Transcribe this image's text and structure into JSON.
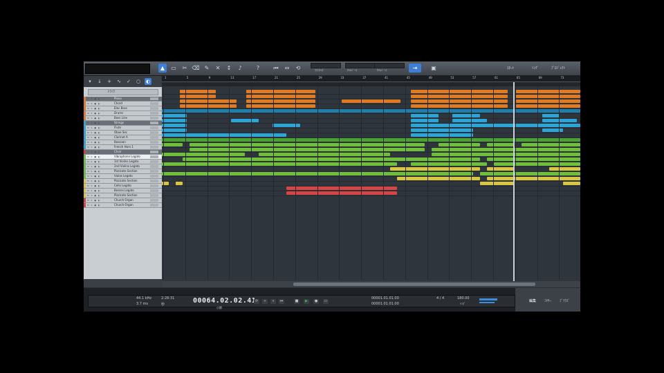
{
  "toolbar": {
    "mode_tags": [
      "ﾓｰﾄﾞ",
      "ｽﾅｯﾌﾟ",
      "ｸｵﾝﾀｲｽﾞ"
    ],
    "mode_labels": [
      "ｸｵﾝﾀｲｽﾞ",
      "ﾀｲﾑﾍﾞｰｽ",
      "ﾀｲﾑﾍﾞｰｽ"
    ],
    "right_tabs": [
      "ｽﾀｰﾄ",
      "ｿﾝｸﾞ",
      "ﾌﾟﾛｼﾞｪｸﾄ"
    ]
  },
  "track_panel": {
    "search_label": "ﾄﾗｯｸ",
    "tracks": [
      {
        "name": "Piano",
        "color": "#e07b22",
        "folder": true
      },
      {
        "name": "Chord",
        "color": "#e07b22"
      },
      {
        "name": "Elec Bass",
        "color": "#e07b22"
      },
      {
        "name": "Drums",
        "color": "#e07b22"
      },
      {
        "name": "Bass Line",
        "color": "#e07b22"
      },
      {
        "name": "Strings",
        "color": "#2aa7d8",
        "folder": true
      },
      {
        "name": "Flute",
        "color": "#2aa7d8"
      },
      {
        "name": "Oboe Sec",
        "color": "#2aa7d8"
      },
      {
        "name": "Clarinet A",
        "color": "#2aa7d8"
      },
      {
        "name": "Bassoon",
        "color": "#2aa7d8"
      },
      {
        "name": "French Horn 1",
        "color": "#2aa7d8"
      },
      {
        "name": "Choir",
        "color": "#c44",
        "folder": true
      },
      {
        "name": "Vibraphone Legato",
        "color": "#6fbf3a",
        "selected": true
      },
      {
        "name": "1st Violins Legato",
        "color": "#6fbf3a"
      },
      {
        "name": "2nd Violins Legato",
        "color": "#6fbf3a"
      },
      {
        "name": "Pizzicato Section",
        "color": "#6fbf3a"
      },
      {
        "name": "Violas Legato",
        "color": "#6fbf3a"
      },
      {
        "name": "Pizzicato Section",
        "color": "#d9c640"
      },
      {
        "name": "Cello Legato",
        "color": "#d9c640"
      },
      {
        "name": "Basses Legato",
        "color": "#d9c640"
      },
      {
        "name": "Pizzicato Section",
        "color": "#d9c640"
      },
      {
        "name": "Church Organ",
        "color": "#d64545"
      },
      {
        "name": "Church Organ",
        "color": "#d64545"
      }
    ]
  },
  "ruler": {
    "ticks": [
      "1",
      "5",
      "9",
      "13",
      "17",
      "21",
      "25",
      "29",
      "33",
      "37",
      "41",
      "45",
      "49",
      "53",
      "57",
      "61",
      "65",
      "69",
      "73"
    ]
  },
  "transport": {
    "sample_rate": "44.1 kHz",
    "latency": "3.7 ms",
    "time_display": "2:28:31",
    "time_label": "秒",
    "timecode": "00064.02.02.41",
    "timecode_label": "小節",
    "loop_start": "00001.01.01.00",
    "loop_end": "00001.01.01.00",
    "signature": "4 / 4",
    "tempo": "180.00",
    "tempo_label": "ﾃﾝﾎﾟ",
    "right_buttons": [
      "編集",
      "ﾐｷｻｰ",
      "ﾌﾞﾗｳｽﾞ"
    ]
  },
  "colors": {
    "orange": "#e07b22",
    "cyan": "#2aa7d8",
    "green": "#6fbf3a",
    "yellow": "#d9c640",
    "red": "#d64545",
    "accent": "#3d7fd6"
  }
}
